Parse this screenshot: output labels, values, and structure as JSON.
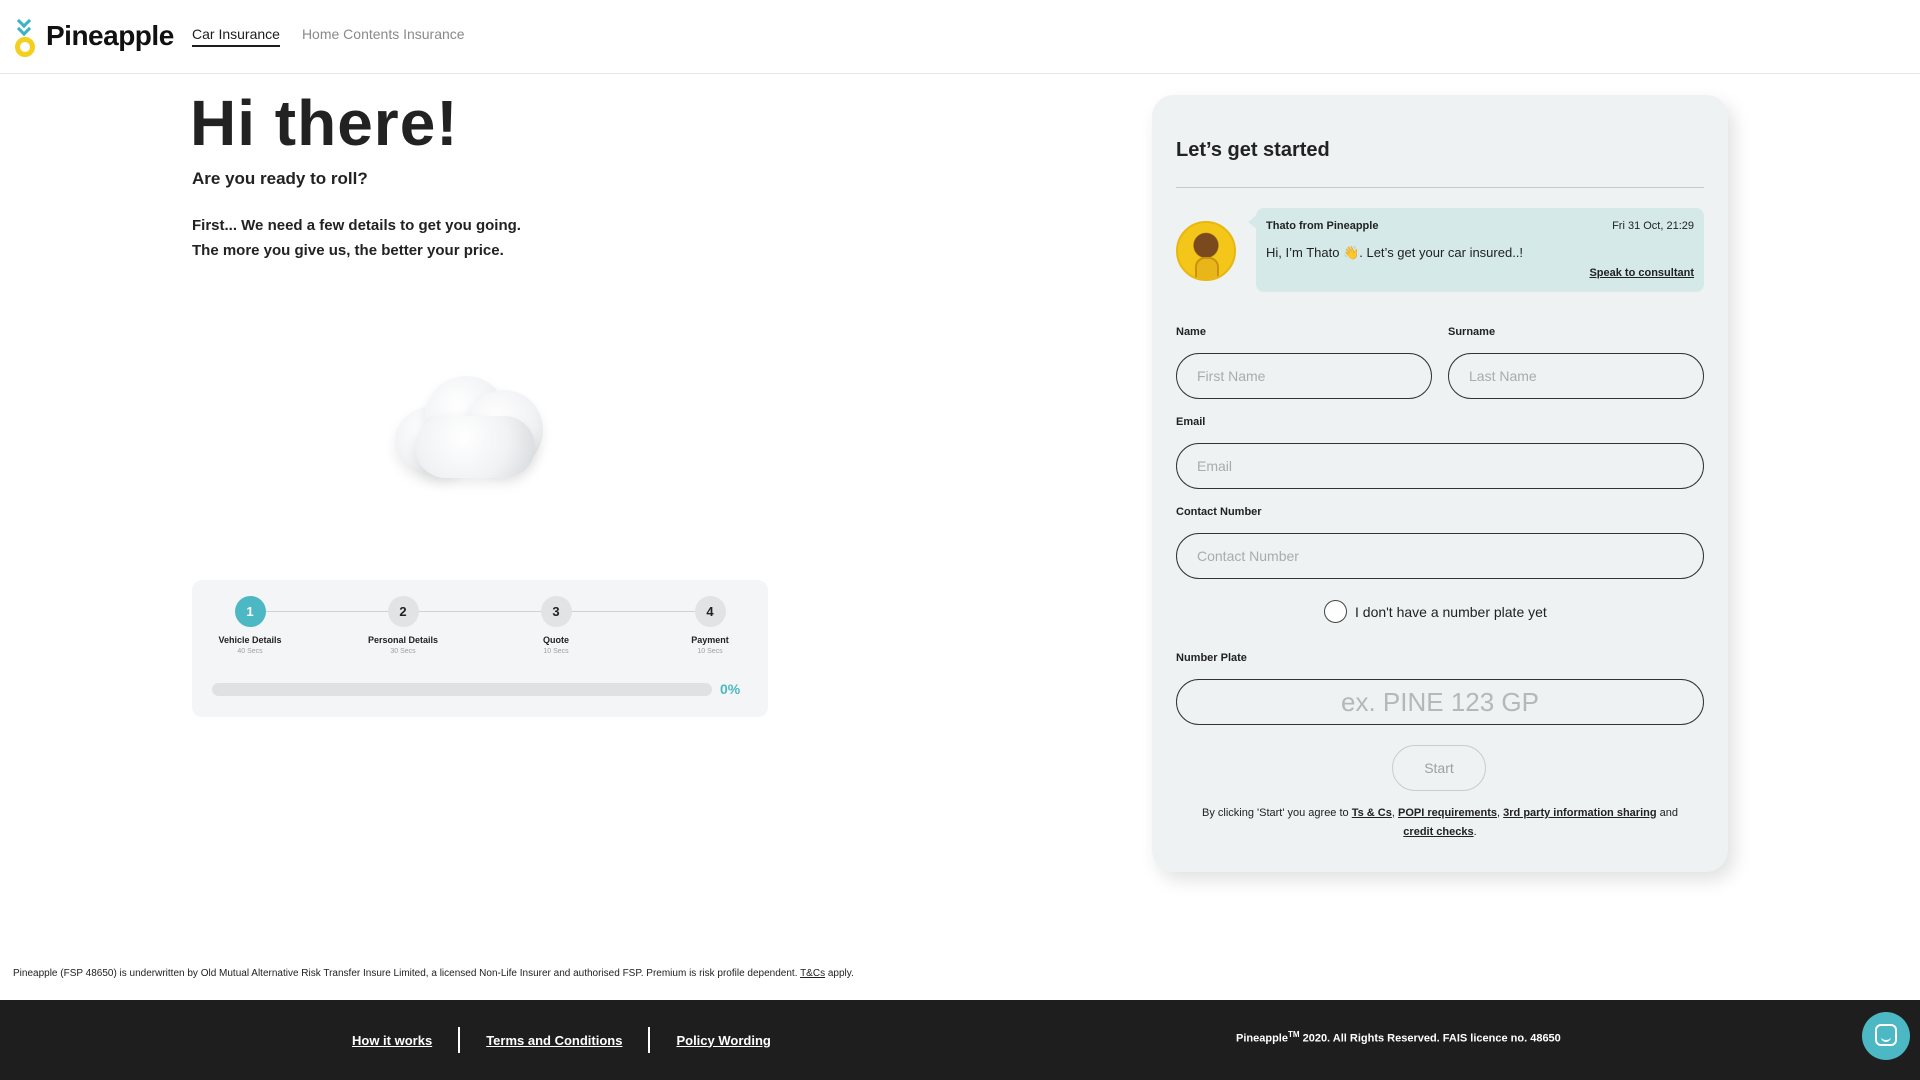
{
  "brand": {
    "name": "Pineapple",
    "accent": "#4bb8c3",
    "yellow": "#f5cf1e"
  },
  "nav": {
    "items": [
      {
        "label": "Car Insurance",
        "active": true
      },
      {
        "label": "Home Contents Insurance",
        "active": false
      }
    ]
  },
  "hero": {
    "title": "Hi there!",
    "subtitle": "Are you ready to roll?",
    "line1": "First... We need a few details to get you going.",
    "line2": "The more you give us, the better your price."
  },
  "progress": {
    "steps": [
      {
        "number": "1",
        "name": "Vehicle Details",
        "time": "40 Secs",
        "active": true
      },
      {
        "number": "2",
        "name": "Personal Details",
        "time": "30 Secs",
        "active": false
      },
      {
        "number": "3",
        "name": "Quote",
        "time": "10 Secs",
        "active": false
      },
      {
        "number": "4",
        "name": "Payment",
        "time": "10 Secs",
        "active": false
      }
    ],
    "percent_label": "0%",
    "value": 0
  },
  "form": {
    "title": "Let’s get started",
    "chat": {
      "from": "Thato from Pineapple",
      "time": "Fri 31 Oct, 21:29",
      "message": "Hi, I’m Thato 👋. Let’s get your car insured..!",
      "link": "Speak to consultant"
    },
    "name": {
      "label": "Name",
      "placeholder": "First Name",
      "value": ""
    },
    "surname": {
      "label": "Surname",
      "placeholder": "Last Name",
      "value": ""
    },
    "email": {
      "label": "Email",
      "placeholder": "Email",
      "value": ""
    },
    "contact": {
      "label": "Contact Number",
      "placeholder": "Contact Number",
      "value": ""
    },
    "no_plate": {
      "label": "I don't have a number plate yet",
      "checked": false
    },
    "plate": {
      "label": "Number Plate",
      "placeholder": "ex. PINE 123 GP",
      "value": ""
    },
    "start_label": "Start",
    "terms": {
      "prefix": "By clicking 'Start' you agree to ",
      "tcs": "Ts & Cs",
      "sep1": ", ",
      "popi": "POPI requirements",
      "sep2": ", ",
      "third_party": "3rd party information sharing",
      "and": " and ",
      "credit": "credit checks",
      "end": "."
    }
  },
  "disclaimer": {
    "text": "Pineapple (FSP 48650) is underwritten by Old Mutual Alternative Risk Transfer Insure Limited, a licensed Non-Life Insurer and authorised FSP. Premium is risk profile dependent. ",
    "link": "T&Cs",
    "end": " apply."
  },
  "footer": {
    "links": [
      "How it works",
      "Terms and Conditions",
      "Policy Wording"
    ],
    "copyright_brand": "Pineapple",
    "copyright_tm": "TM",
    "copyright_rest": " 2020. All Rights Reserved. FAIS licence no. 48650"
  },
  "icons": {
    "logo": "pineapple-logo-icon",
    "chat": "chat-bubble-icon",
    "avatar": "consultant-avatar"
  }
}
